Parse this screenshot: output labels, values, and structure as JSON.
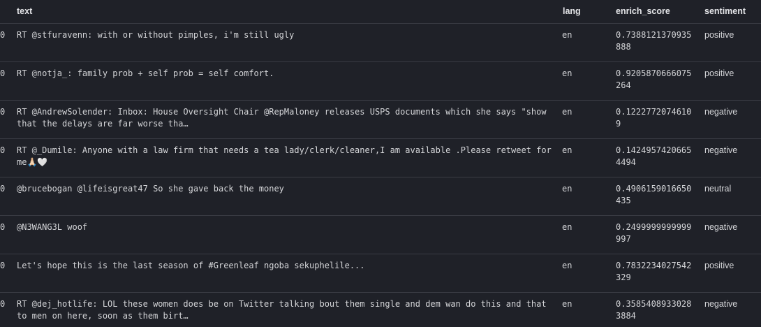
{
  "columns": {
    "text": "text",
    "lang": "lang",
    "enrich_score": "enrich_score",
    "sentiment": "sentiment"
  },
  "rows": [
    {
      "idx": "0",
      "text": "RT @stfuravenn: with or without pimples, i'm still ugly",
      "lang": "en",
      "enrich_score": "0.7388121370935888",
      "sentiment": "positive"
    },
    {
      "idx": "0",
      "text": "RT @notja_: family prob + self prob = self comfort.",
      "lang": "en",
      "enrich_score": "0.9205870666075264",
      "sentiment": "positive"
    },
    {
      "idx": "0",
      "text": "RT @AndrewSolender: Inbox: House Oversight Chair @RepMaloney releases USPS documents which she says \"show that the delays are far worse tha…",
      "lang": "en",
      "enrich_score": "0.12227720746109",
      "sentiment": "negative"
    },
    {
      "idx": "0",
      "text": "RT @_Dumile: Anyone with a law firm that needs a tea lady/clerk/cleaner,I am available .Please retweet for me🙏🏻🤍",
      "lang": "en",
      "enrich_score": "0.14249574206654494",
      "sentiment": "negative"
    },
    {
      "idx": "0",
      "text": "@brucebogan @lifeisgreat47 So she gave back the money",
      "lang": "en",
      "enrich_score": "0.4906159016650435",
      "sentiment": "neutral"
    },
    {
      "idx": "0",
      "text": "@N3WANG3L woof",
      "lang": "en",
      "enrich_score": "0.2499999999999997",
      "sentiment": "negative"
    },
    {
      "idx": "0",
      "text": "Let's hope this is the last season of #Greenleaf ngoba sekuphelile...",
      "lang": "en",
      "enrich_score": "0.7832234027542329",
      "sentiment": "positive"
    },
    {
      "idx": "0",
      "text": "RT @dej_hotlife: LOL these women does be on Twitter talking bout them single and dem wan do this and that to men on here, soon as them birt…",
      "lang": "en",
      "enrich_score": "0.35854089330283884",
      "sentiment": "negative"
    }
  ]
}
